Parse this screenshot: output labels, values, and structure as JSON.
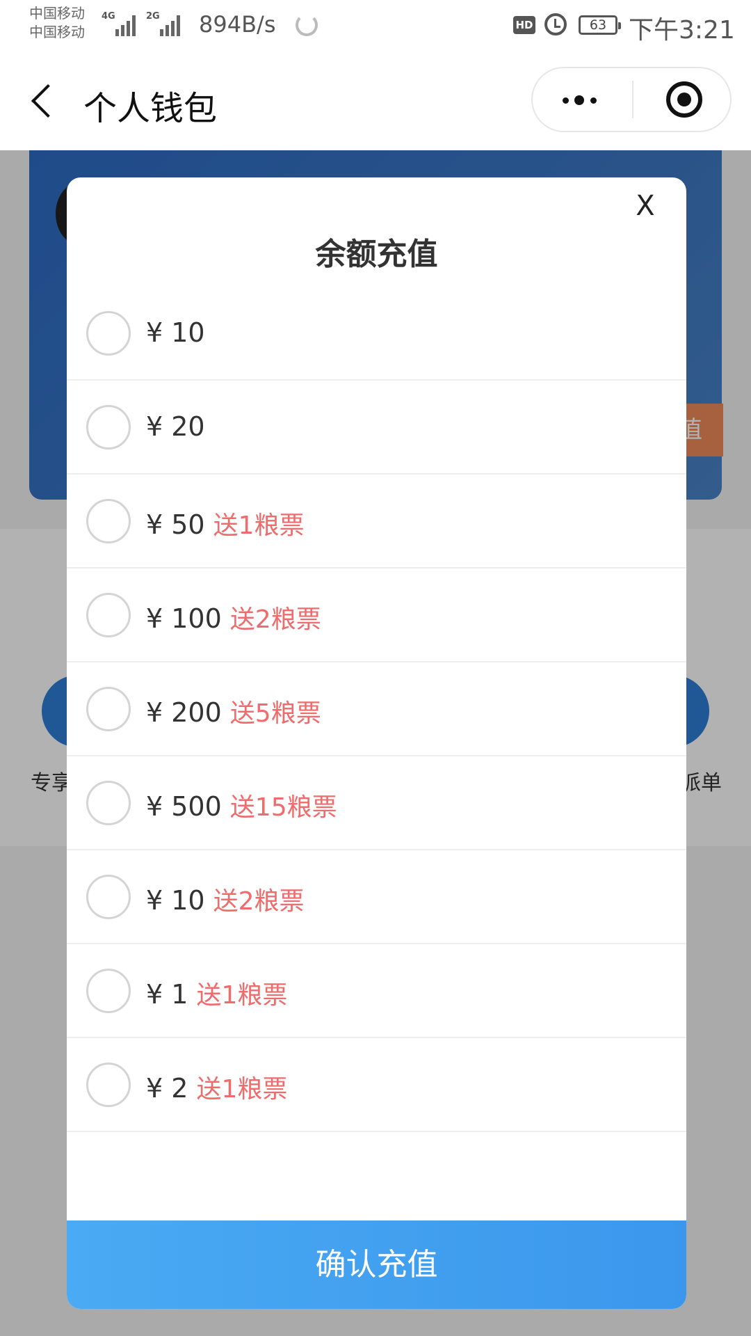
{
  "status_bar": {
    "carrier_1": "中国移动",
    "carrier_2": "中国移动",
    "network_1": "4G",
    "network_2": "2G",
    "net_speed": "894B/s",
    "hd_badge": "HD",
    "battery_level": "63",
    "time": "下午3:21"
  },
  "nav": {
    "title": "个人钱包",
    "back_icon": "chevron-left-icon",
    "more_icon": "more-dots-icon",
    "close_icon": "target-circle-icon"
  },
  "background": {
    "recharge_fragment": "值",
    "left_label_fragment": "专享",
    "right_label_fragment": "派单",
    "card_color": "#2d6cc4"
  },
  "modal": {
    "close_label": "X",
    "title": "余额充值",
    "options": [
      {
        "price": "¥ 10",
        "bonus": ""
      },
      {
        "price": "¥ 20",
        "bonus": ""
      },
      {
        "price": "¥ 50",
        "bonus": "送1粮票"
      },
      {
        "price": "¥ 100",
        "bonus": "送2粮票"
      },
      {
        "price": "¥ 200",
        "bonus": "送5粮票"
      },
      {
        "price": "¥ 500",
        "bonus": "送15粮票"
      },
      {
        "price": "¥ 10",
        "bonus": "送2粮票"
      },
      {
        "price": "¥ 1",
        "bonus": "送1粮票"
      },
      {
        "price": "¥ 2",
        "bonus": "送1粮票"
      }
    ],
    "confirm_label": "确认充值",
    "accent_color": "#3d9bed",
    "bonus_color": "#f06b6b"
  }
}
